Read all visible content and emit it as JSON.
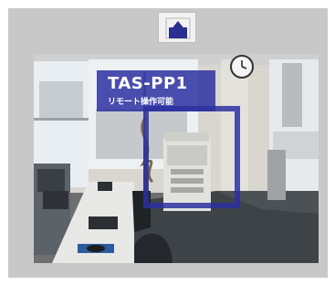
{
  "device": {
    "name": "TAS-PP1",
    "status": "リモート操作可能"
  },
  "controls": {
    "navigate_up": "up-arrow-icon"
  },
  "colors": {
    "panel_background": "#c8c8c8",
    "overlay_accent": "#2b30a0",
    "label_text": "#ffffff"
  }
}
